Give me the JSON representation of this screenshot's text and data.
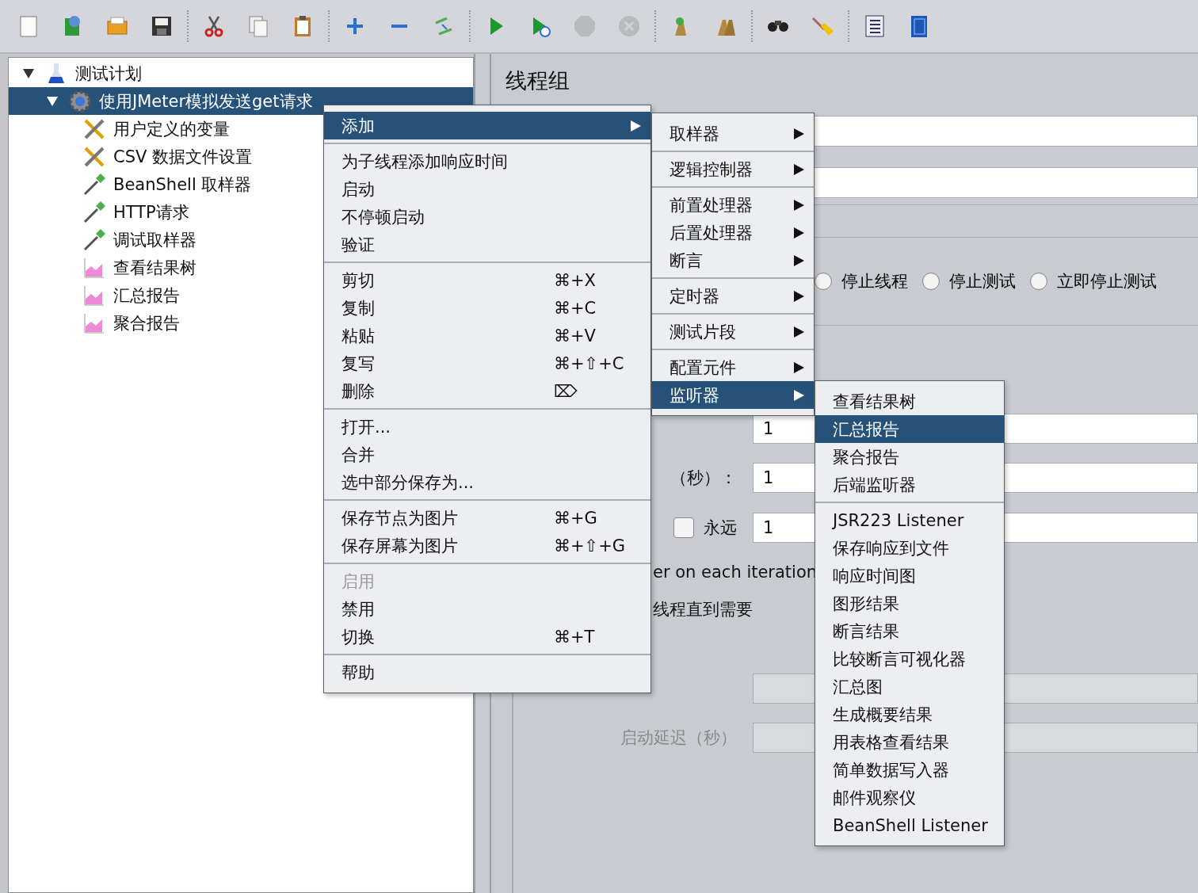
{
  "toolbar": [
    [
      {
        "kind": "new",
        "disabled": false
      },
      {
        "kind": "templates",
        "disabled": false
      },
      {
        "kind": "open",
        "disabled": false
      },
      {
        "kind": "save",
        "disabled": false
      }
    ],
    [
      {
        "kind": "cut",
        "disabled": false
      },
      {
        "kind": "copy",
        "disabled": false
      },
      {
        "kind": "paste",
        "disabled": false
      }
    ],
    [
      {
        "kind": "expand",
        "disabled": false
      },
      {
        "kind": "collapse",
        "disabled": false
      },
      {
        "kind": "toggle",
        "disabled": false
      }
    ],
    [
      {
        "kind": "start",
        "disabled": false
      },
      {
        "kind": "start_no_pause",
        "disabled": false
      },
      {
        "kind": "stop",
        "disabled": true
      },
      {
        "kind": "shutdown",
        "disabled": true
      }
    ],
    [
      {
        "kind": "clear",
        "disabled": false
      },
      {
        "kind": "clear_all",
        "disabled": false
      }
    ],
    [
      {
        "kind": "search",
        "disabled": false
      },
      {
        "kind": "reset_search",
        "disabled": false
      }
    ],
    [
      {
        "kind": "functions",
        "disabled": false
      },
      {
        "kind": "help",
        "disabled": false
      }
    ]
  ],
  "tree": {
    "label": "测试计划",
    "kind": "plan",
    "expanded": true,
    "selected": false,
    "children": [
      {
        "label": "使用JMeter模拟发送get请求",
        "kind": "thread_group",
        "expanded": true,
        "selected": true,
        "children": [
          {
            "label": "用户定义的变量",
            "kind": "config",
            "selected": false
          },
          {
            "label": "CSV 数据文件设置",
            "kind": "config",
            "selected": false
          },
          {
            "label": "BeanShell 取样器",
            "kind": "sampler",
            "selected": false
          },
          {
            "label": "HTTP请求",
            "kind": "sampler",
            "selected": false
          },
          {
            "label": "调试取样器",
            "kind": "sampler",
            "selected": false
          },
          {
            "label": "查看结果树",
            "kind": "listener",
            "selected": false
          },
          {
            "label": "汇总报告",
            "kind": "listener",
            "selected": false
          },
          {
            "label": "聚合报告",
            "kind": "listener",
            "selected": false
          }
        ]
      }
    ]
  },
  "panel": {
    "title": "线程组",
    "radios": [
      {
        "label": "停止线程",
        "selected": false
      },
      {
        "label": "停止测试",
        "selected": false
      },
      {
        "label": "立即停止测试",
        "selected": false
      }
    ],
    "rows": [
      {
        "kind": "input",
        "value": "1",
        "disabled": false
      },
      {
        "kind": "input",
        "label": "（秒）：",
        "value": "1",
        "disabled": false
      },
      {
        "kind": "loop",
        "checkbox": {
          "label": "永远",
          "checked": false
        },
        "value": "1"
      },
      {
        "kind": "text",
        "label": "er on each iteration"
      },
      {
        "kind": "text",
        "label": "线程直到需要"
      },
      {
        "kind": "input",
        "disabled": true
      },
      {
        "kind": "input",
        "label": "启动延迟（秒）",
        "disabled": true
      }
    ]
  },
  "context_menu": {
    "sections": [
      [
        {
          "label": "添加",
          "submenu": true,
          "selected": true,
          "disabled": false
        }
      ],
      [
        {
          "label": "为子线程添加响应时间",
          "selected": false,
          "disabled": false
        },
        {
          "label": "启动",
          "selected": false,
          "disabled": false
        },
        {
          "label": "不停顿启动",
          "selected": false,
          "disabled": false
        },
        {
          "label": "验证",
          "selected": false,
          "disabled": false
        }
      ],
      [
        {
          "label": "剪切",
          "shortcut": "⌘+X",
          "selected": false,
          "disabled": false
        },
        {
          "label": "复制",
          "shortcut": "⌘+C",
          "selected": false,
          "disabled": false
        },
        {
          "label": "粘贴",
          "shortcut": "⌘+V",
          "selected": false,
          "disabled": false
        },
        {
          "label": "复写",
          "shortcut": "⌘+⇧+C",
          "selected": false,
          "disabled": false
        },
        {
          "label": "删除",
          "shortcut": "⌦",
          "selected": false,
          "disabled": false
        }
      ],
      [
        {
          "label": "打开...",
          "selected": false,
          "disabled": false
        },
        {
          "label": "合并",
          "selected": false,
          "disabled": false
        },
        {
          "label": "选中部分保存为...",
          "selected": false,
          "disabled": false
        }
      ],
      [
        {
          "label": "保存节点为图片",
          "shortcut": "⌘+G",
          "selected": false,
          "disabled": false
        },
        {
          "label": "保存屏幕为图片",
          "shortcut": "⌘+⇧+G",
          "selected": false,
          "disabled": false
        }
      ],
      [
        {
          "label": "启用",
          "selected": false,
          "disabled": true
        },
        {
          "label": "禁用",
          "selected": false,
          "disabled": false
        },
        {
          "label": "切换",
          "shortcut": "⌘+T",
          "selected": false,
          "disabled": false
        }
      ],
      [
        {
          "label": "帮助",
          "selected": false,
          "disabled": false
        }
      ]
    ]
  },
  "add_submenu": {
    "sections": [
      [
        {
          "label": "取样器",
          "submenu": true,
          "selected": false
        }
      ],
      [
        {
          "label": "逻辑控制器",
          "submenu": true,
          "selected": false
        }
      ],
      [
        {
          "label": "前置处理器",
          "submenu": true,
          "selected": false
        },
        {
          "label": "后置处理器",
          "submenu": true,
          "selected": false
        },
        {
          "label": "断言",
          "submenu": true,
          "selected": false
        }
      ],
      [
        {
          "label": "定时器",
          "submenu": true,
          "selected": false
        }
      ],
      [
        {
          "label": "测试片段",
          "submenu": true,
          "selected": false
        }
      ],
      [
        {
          "label": "配置元件",
          "submenu": true,
          "selected": false
        },
        {
          "label": "监听器",
          "submenu": true,
          "selected": true
        }
      ]
    ]
  },
  "listener_submenu": {
    "sections": [
      [
        {
          "label": "查看结果树",
          "selected": false
        },
        {
          "label": "汇总报告",
          "selected": true
        },
        {
          "label": "聚合报告",
          "selected": false
        },
        {
          "label": "后端监听器",
          "selected": false
        }
      ],
      [
        {
          "label": "JSR223 Listener",
          "selected": false
        },
        {
          "label": "保存响应到文件",
          "selected": false
        },
        {
          "label": "响应时间图",
          "selected": false
        },
        {
          "label": "图形结果",
          "selected": false
        },
        {
          "label": "断言结果",
          "selected": false
        },
        {
          "label": "比较断言可视化器",
          "selected": false
        },
        {
          "label": "汇总图",
          "selected": false
        },
        {
          "label": "生成概要结果",
          "selected": false
        },
        {
          "label": "用表格查看结果",
          "selected": false
        },
        {
          "label": "简单数据写入器",
          "selected": false
        },
        {
          "label": "邮件观察仪",
          "selected": false
        },
        {
          "label": "BeanShell Listener",
          "selected": false
        }
      ]
    ]
  }
}
